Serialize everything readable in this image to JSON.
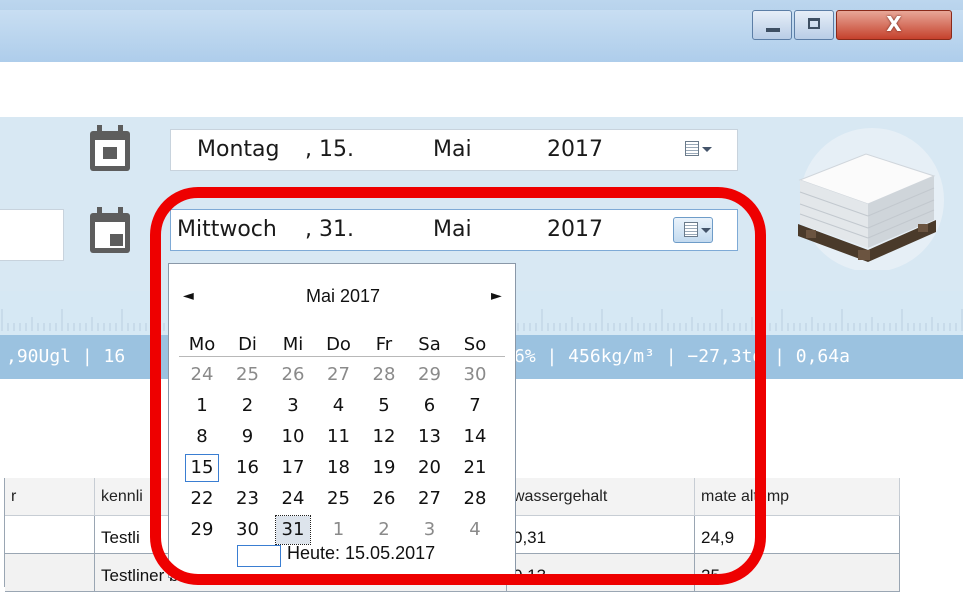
{
  "window": {
    "minimize_icon": "minimize-icon",
    "maximize_icon": "maximize-icon",
    "close_icon": "close-icon",
    "close_glyph": "X"
  },
  "date_range": {
    "from": {
      "weekday": "Montag",
      "day": ", 15.",
      "month": "Mai",
      "year": "2017"
    },
    "to": {
      "weekday": "Mittwoch",
      "day": ", 31.",
      "month": "Mai",
      "year": "2017"
    }
  },
  "info_bar": {
    "left": ",90Ugl | 16",
    "right": "6% | 456kg/m³ | −27,3td | 0,64a"
  },
  "calendar": {
    "title": "Mai 2017",
    "prev_glyph": "◄",
    "next_glyph": "►",
    "weekdays": [
      "Mo",
      "Di",
      "Mi",
      "Do",
      "Fr",
      "Sa",
      "So"
    ],
    "weeks": [
      [
        "24",
        "25",
        "26",
        "27",
        "28",
        "29",
        "30"
      ],
      [
        "1",
        "2",
        "3",
        "4",
        "5",
        "6",
        "7"
      ],
      [
        "8",
        "9",
        "10",
        "11",
        "12",
        "13",
        "14"
      ],
      [
        "15",
        "16",
        "17",
        "18",
        "19",
        "20",
        "21"
      ],
      [
        "22",
        "23",
        "24",
        "25",
        "26",
        "27",
        "28"
      ],
      [
        "29",
        "30",
        "31",
        "1",
        "2",
        "3",
        "4"
      ]
    ],
    "today_label": "Heute: 15.05.2017"
  },
  "table": {
    "headers": [
      "r",
      "kennli",
      "wassergehalt",
      "mate altemp"
    ],
    "rows": [
      [
        "",
        "Testli",
        "0,31",
        "24,9"
      ],
      [
        "",
        "Testliner braun | 35 | 15.05.2017 10:14",
        "0,13",
        "25"
      ]
    ]
  },
  "colors": {
    "highlight": "#ee0000",
    "panel": "#d8e8f3",
    "info_bar": "#9bc2e0",
    "accent": "#3a7ed2"
  }
}
